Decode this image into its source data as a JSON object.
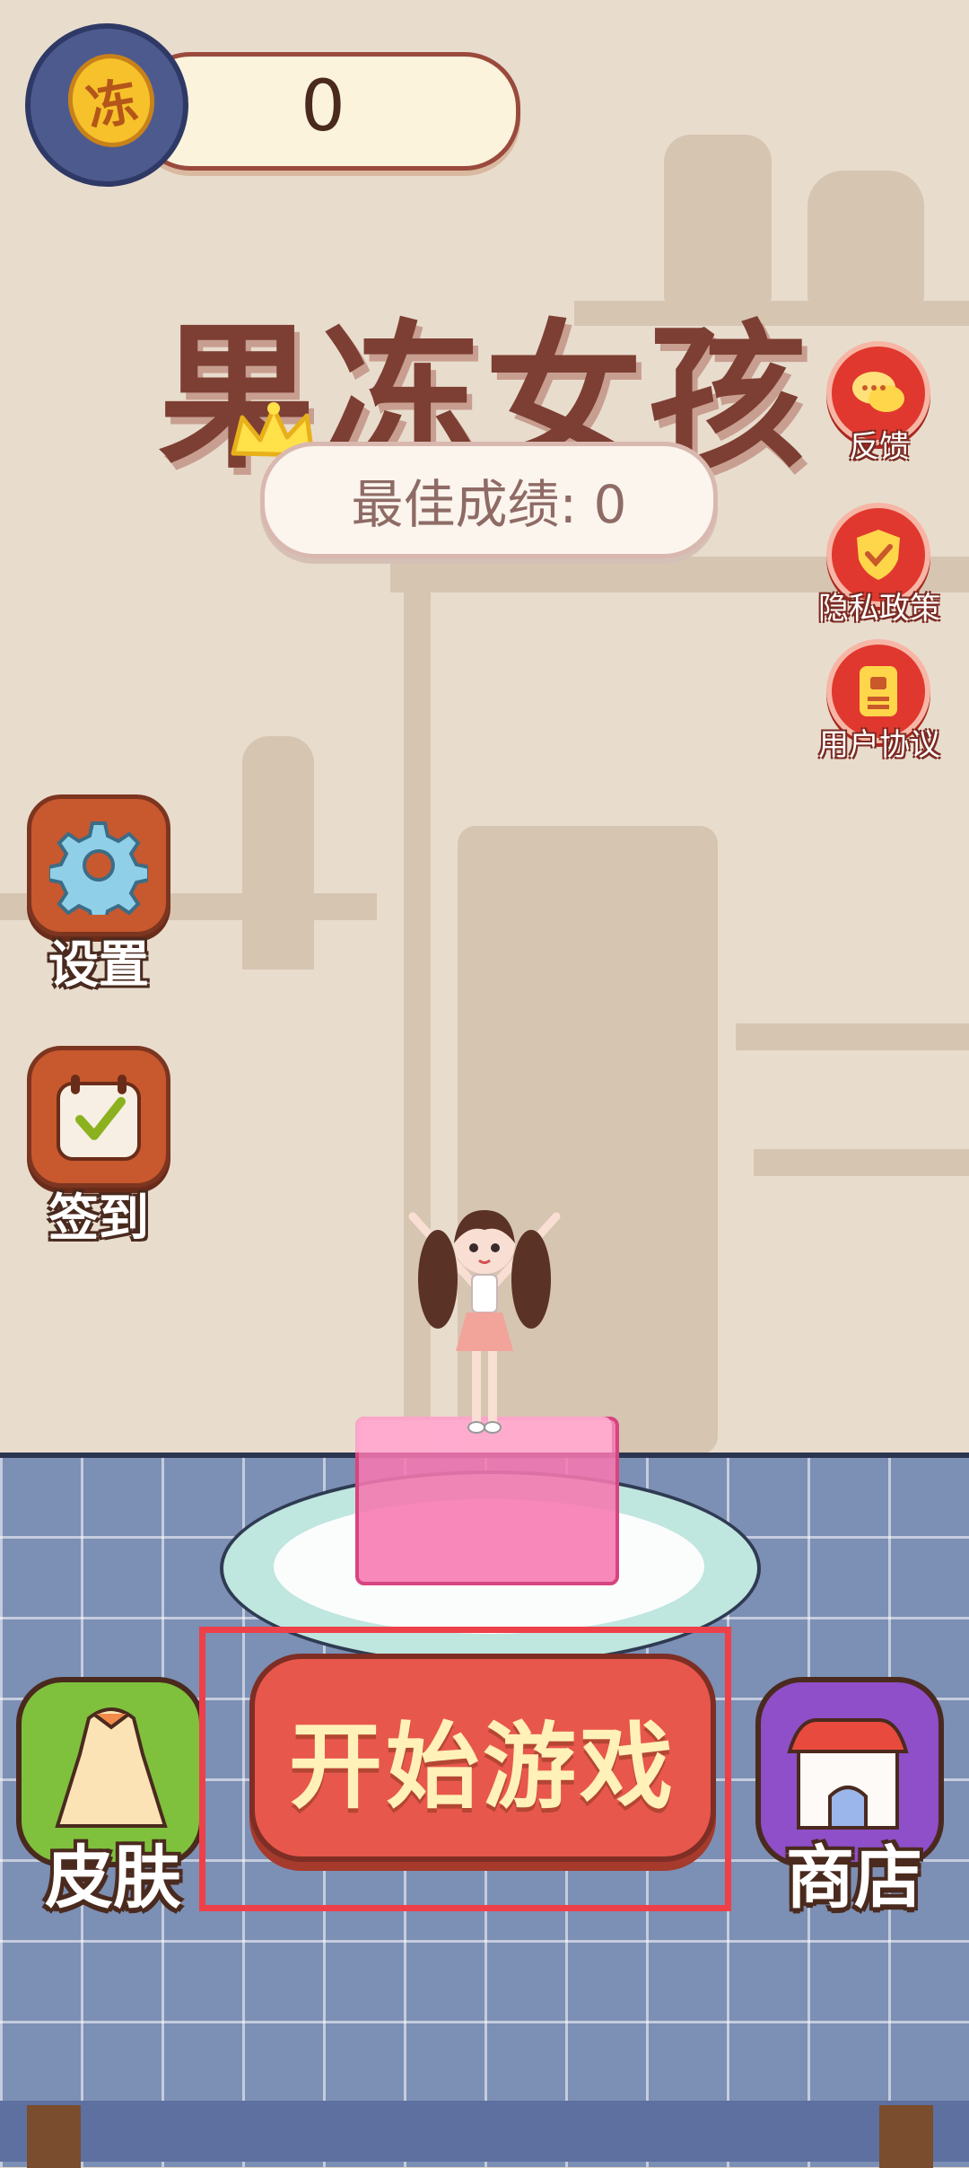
{
  "coin_bar": {
    "icon_char": "冻",
    "value": "0"
  },
  "title": "果冻女孩",
  "best_score": {
    "label": "最佳成绩: 0"
  },
  "right_menu": [
    {
      "label": "反馈",
      "icon": "chat-bubble-icon"
    },
    {
      "label": "隐私政策",
      "icon": "shield-check-icon"
    },
    {
      "label": "用户协议",
      "icon": "document-icon"
    }
  ],
  "left_menu": [
    {
      "label": "设置",
      "icon": "gear-icon"
    },
    {
      "label": "签到",
      "icon": "calendar-check-icon"
    }
  ],
  "bottom": {
    "skin_label": "皮肤",
    "start_label": "开始游戏",
    "shop_label": "商店"
  },
  "colors": {
    "accent": "#e8574c",
    "highlight": "#ee4049",
    "skin": "#7fc13d",
    "shop": "#8e4fc8"
  }
}
